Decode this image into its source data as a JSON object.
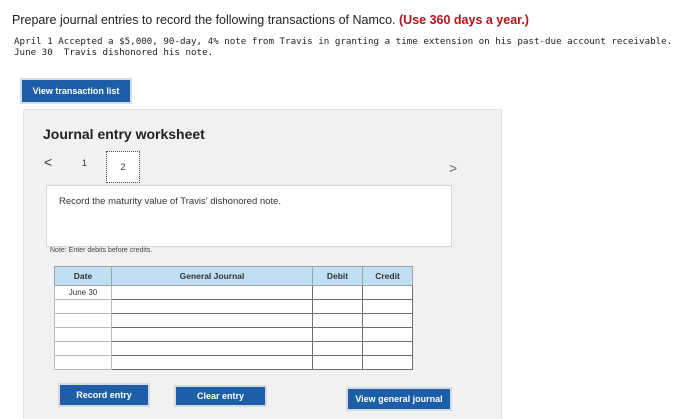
{
  "question": {
    "prompt": "Prepare journal entries to record the following transactions of Namco.",
    "highlight": "(Use 360 days a year.)",
    "transactions": [
      "April 1 Accepted a $5,000, 90-day, 4% note from Travis in granting a time extension on his past-due account receivable.",
      "June 30  Travis dishonored his note."
    ]
  },
  "buttons": {
    "view_transaction_list": "View transaction list",
    "record_entry": "Record entry",
    "clear_entry": "Clear entry",
    "view_general_journal": "View general journal"
  },
  "worksheet": {
    "title": "Journal entry worksheet",
    "prev": "<",
    "next": ">",
    "pages": [
      "1",
      "2"
    ],
    "instruction": "Record the maturity value of Travis' dishonored note.",
    "note": "Note: Enter debits before credits."
  },
  "table": {
    "headers": [
      "Date",
      "General Journal",
      "Debit",
      "Credit"
    ],
    "rows": [
      {
        "date": "June 30"
      },
      {
        "date": ""
      },
      {
        "date": ""
      },
      {
        "date": ""
      },
      {
        "date": ""
      },
      {
        "date": ""
      }
    ]
  }
}
